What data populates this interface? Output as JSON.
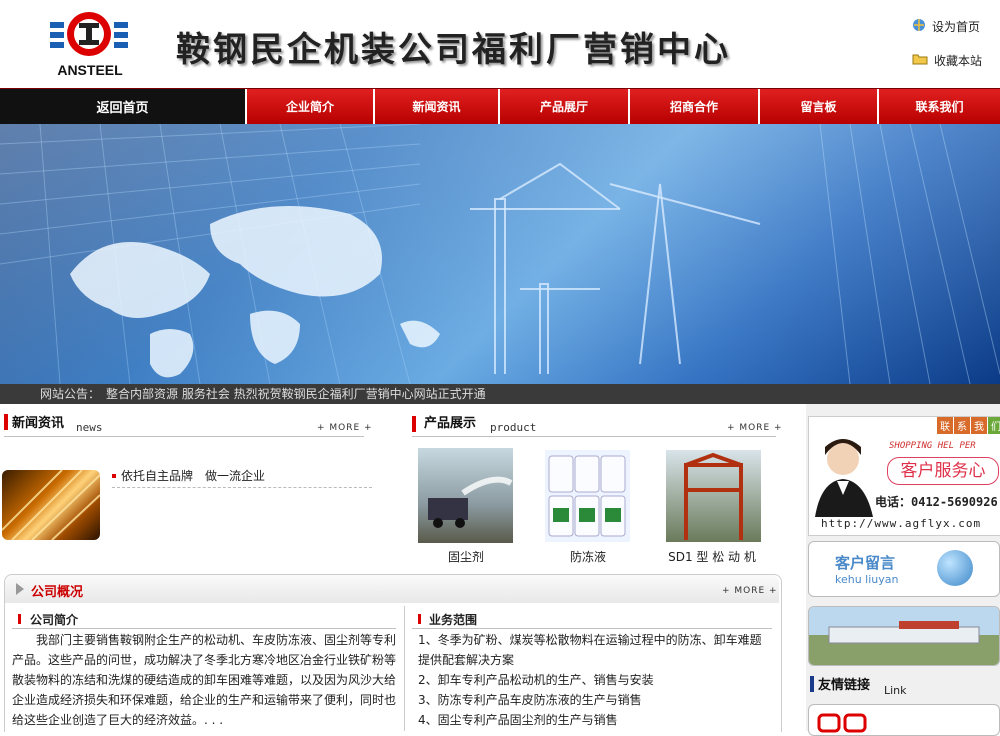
{
  "header": {
    "logo_text": "ANSTEEL",
    "site_title": "鞍钢民企机装公司福利厂营销中心",
    "set_home": "设为首页",
    "bookmark": "收藏本站"
  },
  "nav": {
    "home": "返回首页",
    "items": [
      "企业简介",
      "新闻资讯",
      "产品展厅",
      "招商合作",
      "留言板",
      "联系我们"
    ]
  },
  "notice": {
    "label": "网站公告：",
    "text": "整合内部资源 服务社会 热烈祝贺鞍钢民企福利厂营销中心网站正式开通"
  },
  "news": {
    "title": "新闻资讯",
    "subtitle": "news",
    "more": "+ MORE +",
    "items": [
      "依托自主品牌　做一流企业"
    ]
  },
  "products": {
    "title": "产品展示",
    "subtitle": "product",
    "more": "+ MORE +",
    "items": [
      "固尘剂",
      "防冻液",
      "SD1 型 松 动 机"
    ]
  },
  "overview": {
    "title": "公司概况",
    "more": "+ MORE +",
    "intro_title": "公司简介",
    "intro_text": "我部门主要销售鞍钢附企生产的松动机、车皮防冻液、固尘剂等专利产品。这些产品的问世，成功解决了冬季北方寒冷地区冶金行业铁矿粉等散装物料的冻结和洗煤的硬结造成的卸车困难等难题，以及因为风沙大给企业造成经济损失和环保难题，给企业的生产和运输带来了便利，同时也给这些企业创造了巨大的经济效益。. . .",
    "scope_title": "业务范围",
    "scope_items": [
      "1、冬季为矿粉、煤炭等松散物料在运输过程中的防冻、卸车难题提供配套解决方案",
      "2、卸车专利产品松动机的生产、销售与安装",
      "3、防冻专利产品车皮防冻液的生产与销售",
      "4、固尘专利产品固尘剂的生产与销售"
    ]
  },
  "sidebar": {
    "contact_tabs": [
      "联",
      "系",
      "我",
      "们"
    ],
    "shopping_help": "SHOPPING HEL PER",
    "service_center": "客户服务心",
    "phone": "电话：0412-5690926",
    "url": "http://www.agflyx.com",
    "message_title": "客户留言",
    "message_pinyin": "kehu liuyan",
    "links_title": "友情链接",
    "links_sub": "Link"
  },
  "colors": {
    "brand_red": "#cc0000",
    "nav_black": "#111111",
    "banner_blue": "#1b66b8"
  }
}
